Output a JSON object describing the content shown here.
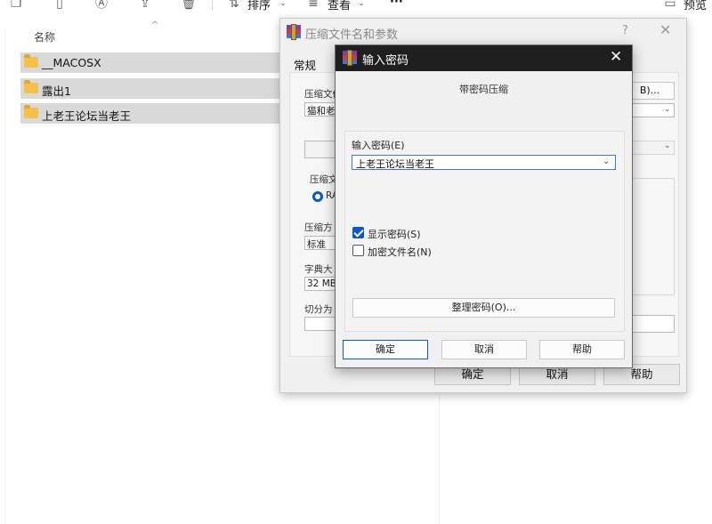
{
  "toolbar": {
    "icons": [
      "copy-icon",
      "paste-icon",
      "rename-icon",
      "share-icon",
      "delete-icon"
    ],
    "sort_label": "排序",
    "view_label": "查看",
    "more_label": "···",
    "preview_label": "预览"
  },
  "explorer": {
    "column_header": "名称",
    "files": [
      {
        "name": "__MACOSX"
      },
      {
        "name": "露出1"
      },
      {
        "name": "上老王论坛当老王"
      }
    ]
  },
  "archive_dialog": {
    "title": "压缩文件名和参数",
    "help": "?",
    "close": "✕",
    "tab_general": "常规",
    "label_archive_name": "压缩文件",
    "archive_name_value": "猫和老",
    "browse_fragment": "B)...",
    "label_format": "压缩文",
    "format_rar_fragment": "RA",
    "label_method": "压缩方",
    "method_value": "标准",
    "label_dict": "字典大",
    "dict_value": "32 MB",
    "label_split": "切分为",
    "ok": "确定",
    "cancel": "取消",
    "help_btn": "帮助"
  },
  "password_dialog": {
    "title": "输入密码",
    "close": "✕",
    "subtitle": "带密码压缩",
    "enter_label": "输入密码(E)",
    "password_value": "上老王论坛当老王",
    "show_password": {
      "label": "显示密码(S)",
      "checked": true
    },
    "encrypt_names": {
      "label": "加密文件名(N)",
      "checked": false
    },
    "manage_label": "整理密码(O)...",
    "ok": "确定",
    "cancel": "取消",
    "help": "帮助"
  }
}
